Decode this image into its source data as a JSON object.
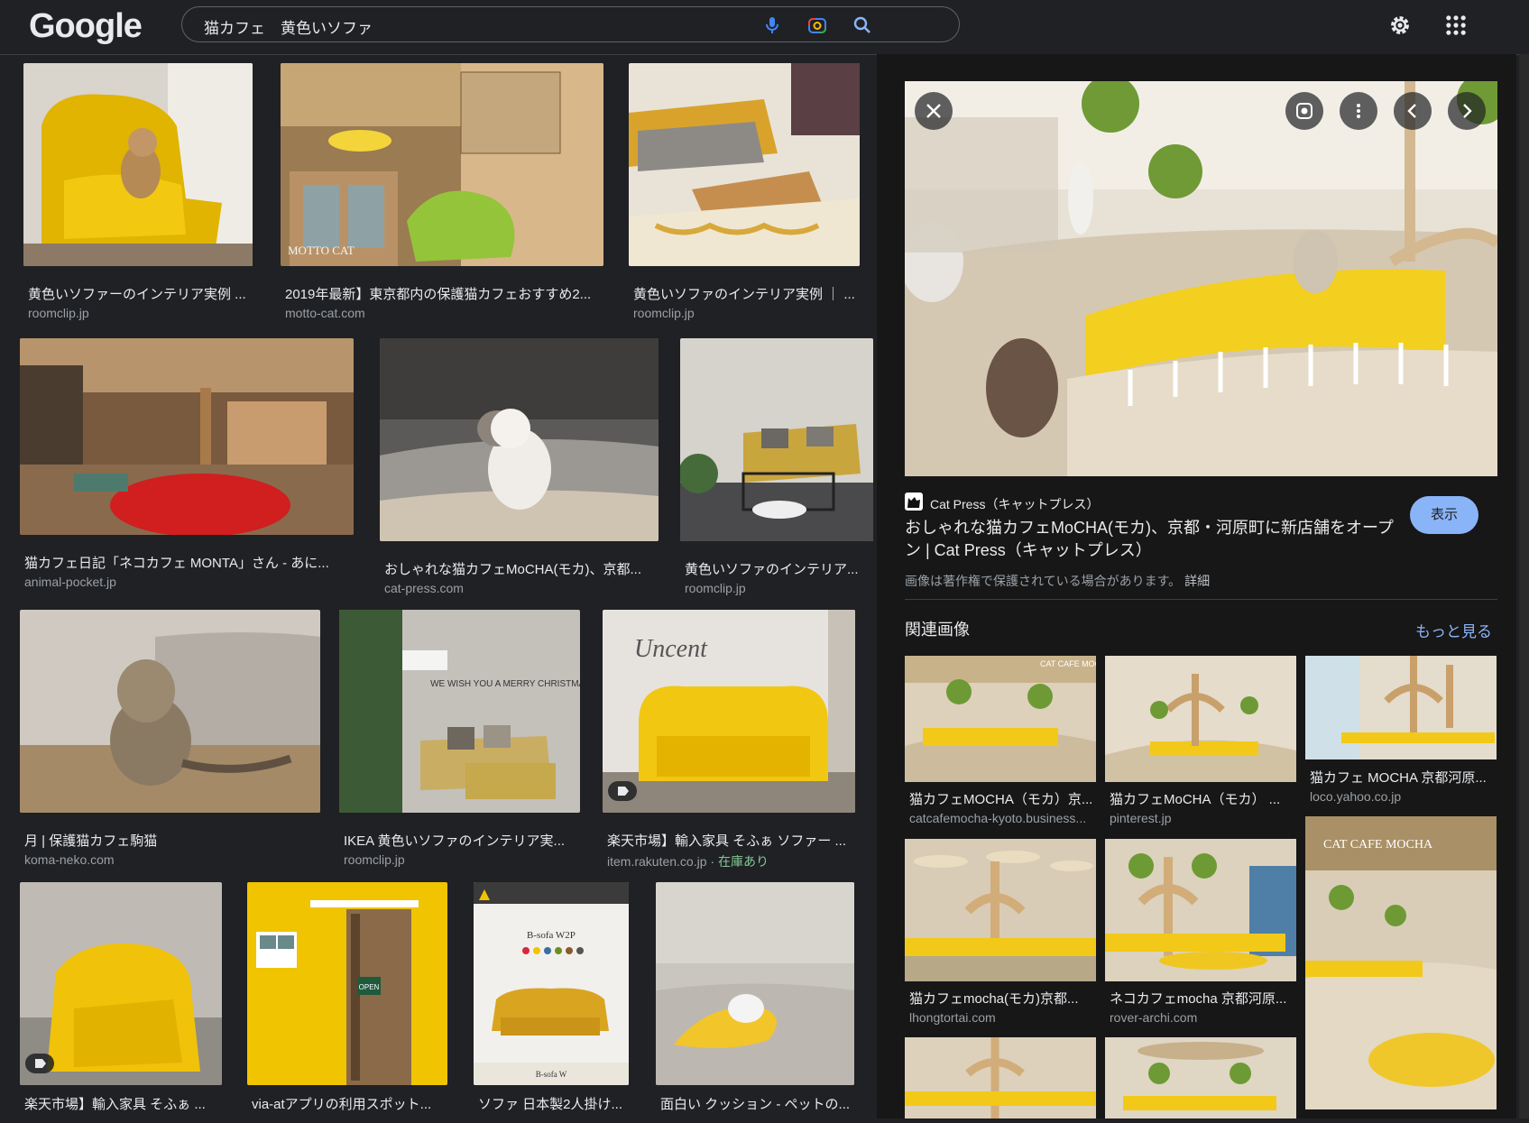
{
  "logo": "Google",
  "search": {
    "query": "猫カフェ　黄色いソファ"
  },
  "icons": {
    "mic": "mic-icon",
    "lens": "lens-icon",
    "search": "search-icon",
    "settings": "gear-icon",
    "apps": "apps-grid-icon",
    "close": "close-icon",
    "lens_preview": "lens-icon",
    "more": "more-vert-icon",
    "prev": "chevron-left-icon",
    "next": "chevron-right-icon",
    "tag": "tag-icon"
  },
  "results": [
    {
      "title": "黄色いソファーのインテリア実例 ...",
      "source": "roomclip.jp"
    },
    {
      "title": "2019年最新】東京都内の保護猫カフェおすすめ2...",
      "source": "motto-cat.com"
    },
    {
      "title": "黄色いソファのインテリア実例 ｜ ...",
      "source": "roomclip.jp"
    },
    {
      "title": "猫カフェ日記「ネコカフェ MONTA」さん - あに...",
      "source": "animal-pocket.jp"
    },
    {
      "title": "おしゃれな猫カフェMoCHA(モカ)、京都...",
      "source": "cat-press.com"
    },
    {
      "title": "黄色いソファのインテリア...",
      "source": "roomclip.jp"
    },
    {
      "title": "月 | 保護猫カフェ駒猫",
      "source": "koma-neko.com"
    },
    {
      "title": "IKEA 黄色いソファのインテリア実...",
      "source": "roomclip.jp"
    },
    {
      "title": "楽天市場】輸入家具 そふぁ ソファー ...",
      "source": "item.rakuten.co.jp",
      "stock": " · 在庫あり"
    },
    {
      "title": "楽天市場】輸入家具 そふぁ ...",
      "source": ""
    },
    {
      "title": "via-atアプリの利用スポット...",
      "source": ""
    },
    {
      "title": "ソファ 日本製2人掛け...",
      "source": ""
    },
    {
      "title": "面白い クッション - ペットの...",
      "source": ""
    }
  ],
  "image_text": {
    "motto_cat": "MOTTO CAT",
    "ikea_wall": "WE WISH YOU A MERRY CHRISTMAS",
    "script_sign": "Uncent",
    "open_sign": "OPEN",
    "bsofa": "B-sofa W2P",
    "bsofa_small": "B-sofa W"
  },
  "preview": {
    "source_name": "Cat Press（キャットプレス）",
    "title": "おしゃれな猫カフェMoCHA(モカ)、京都・河原町に新店舗をオープン | Cat Press（キャットプレス）",
    "view_button": "表示",
    "copyright": "画像は著作権で保護されている場合があります。",
    "details_link": "詳細",
    "related_heading": "関連画像",
    "see_more": "もっと見る"
  },
  "related": [
    {
      "title": "猫カフェMOCHA（モカ）京...",
      "source": "catcafemocha-kyoto.business..."
    },
    {
      "title": "猫カフェMoCHA（モカ） ...",
      "source": "pinterest.jp"
    },
    {
      "title": "猫カフェ MOCHA 京都河原...",
      "source": "loco.yahoo.co.jp"
    },
    {
      "title": "猫カフェmocha(モカ)京都...",
      "source": "lhongtortai.com"
    },
    {
      "title": "ネコカフェmocha 京都河原...",
      "source": "rover-archi.com"
    },
    {
      "title": "",
      "source": ""
    },
    {
      "title": "",
      "source": ""
    },
    {
      "title": "",
      "source": ""
    }
  ],
  "related_image_text": {
    "cafe_sign": "CAT CAFE MOCHA",
    "cafe_sign_short": "CAT CA"
  },
  "colors": {
    "background": "#202124",
    "panel": "#171717",
    "accent": "#8ab4f8",
    "stock": "#81c995",
    "text": "#e8eaed",
    "muted": "#9aa0a6"
  }
}
